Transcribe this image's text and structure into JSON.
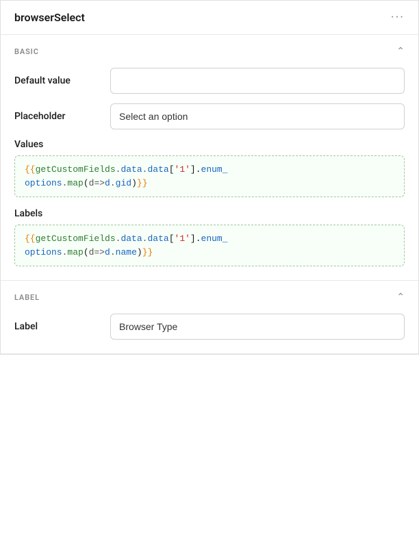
{
  "header": {
    "title": "browserSelect",
    "more_icon": "···"
  },
  "sections": {
    "basic": {
      "title": "BASIC",
      "fields": {
        "default_value": {
          "label": "Default value",
          "value": "",
          "placeholder": ""
        },
        "placeholder": {
          "label": "Placeholder",
          "value": "Select an option",
          "placeholder": ""
        },
        "values": {
          "label": "Values",
          "code_line1": "{{getCustomFields.data.data['1'].enum_",
          "code_line2": "options.map(d=>d.gid)}}"
        },
        "labels": {
          "label": "Labels",
          "code_line1": "{{getCustomFields.data.data['1'].enum_",
          "code_line2": "options.map(d=>d.name)}}"
        }
      }
    },
    "label_section": {
      "title": "LABEL",
      "fields": {
        "label": {
          "label": "Label",
          "value": "Browser Type",
          "placeholder": ""
        }
      }
    }
  },
  "colors": {
    "curly": "#e67e00",
    "func": "#2e7d32",
    "prop": "#1565c0",
    "str": "#c62828"
  }
}
